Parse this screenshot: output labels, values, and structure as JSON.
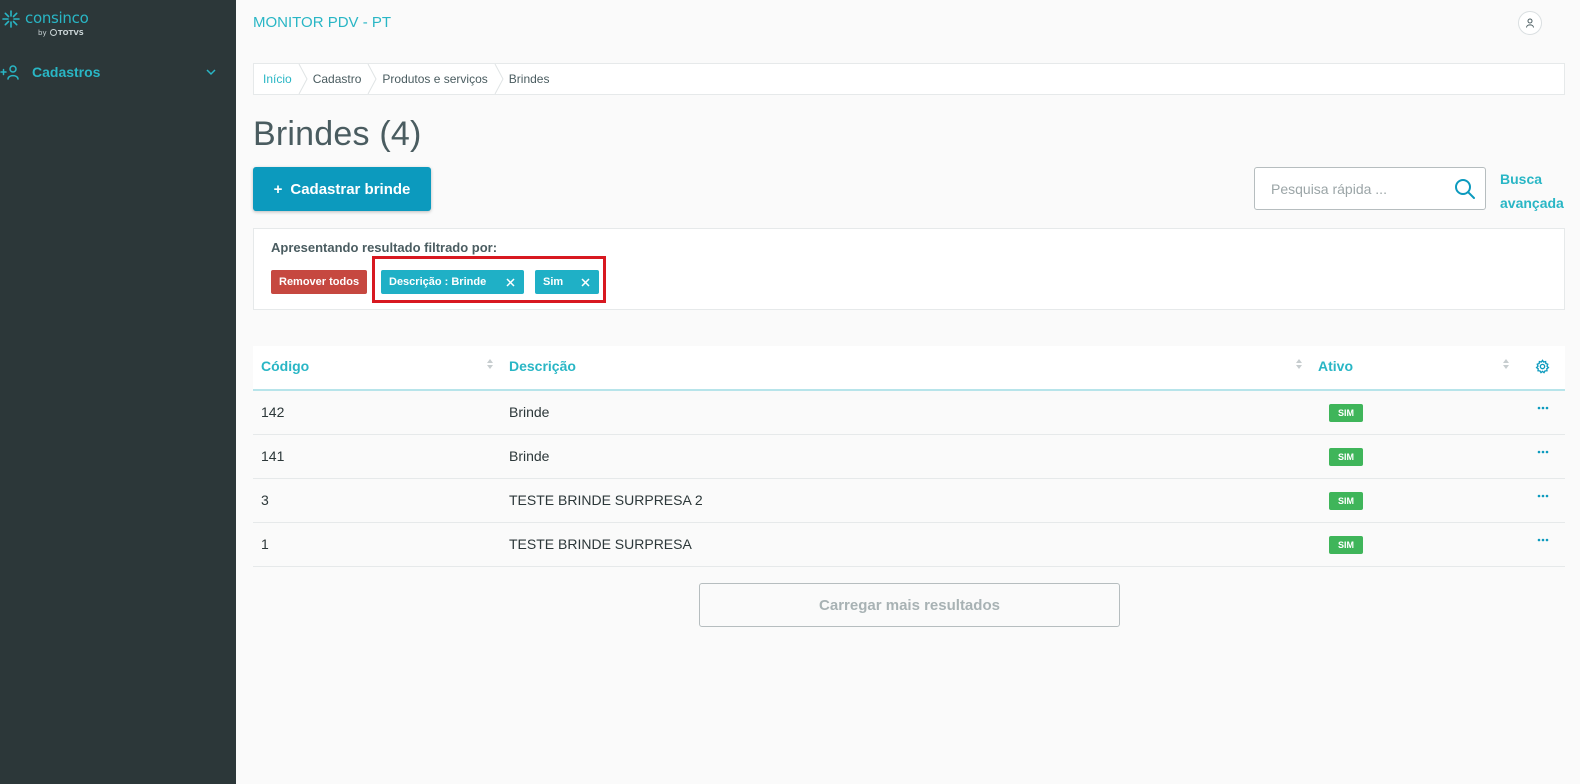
{
  "sidebar": {
    "logo": {
      "text": "consinco",
      "sub_by": "by",
      "sub_brand": "TOTVS"
    },
    "menu": [
      {
        "label": "Cadastros",
        "icon": "add-user-icon",
        "expanded": false
      }
    ]
  },
  "header": {
    "app_title": "MONITOR PDV - PT",
    "avatar_icon": "user-icon"
  },
  "breadcrumb": [
    "Início",
    "Cadastro",
    "Produtos e serviços",
    "Brindes"
  ],
  "page": {
    "title": "Brindes (4)",
    "add_button_icon": "+",
    "add_button_label": "Cadastrar brinde",
    "search_placeholder": "Pesquisa rápida ...",
    "advanced_search_line1": "Busca",
    "advanced_search_line2": "avançada"
  },
  "filters": {
    "label": "Apresentando resultado filtrado por:",
    "remove_all_label": "Remover todos",
    "chips": [
      "Descrição : Brinde",
      "Sim"
    ]
  },
  "table": {
    "columns": [
      "Código",
      "Descrição",
      "Ativo"
    ],
    "rows": [
      {
        "codigo": "142",
        "descricao": "Brinde",
        "ativo": "SIM"
      },
      {
        "codigo": "141",
        "descricao": "Brinde",
        "ativo": "SIM"
      },
      {
        "codigo": "3",
        "descricao": "TESTE BRINDE SURPRESA 2",
        "ativo": "SIM"
      },
      {
        "codigo": "1",
        "descricao": "TESTE BRINDE SURPRESA",
        "ativo": "SIM"
      }
    ]
  },
  "load_more_label": "Carregar mais resultados",
  "colors": {
    "sidebar_bg": "#2c3739",
    "accent": "#29b6c5",
    "primary_button": "#0c9abe",
    "danger": "#c64840",
    "chip": "#1fb0c6",
    "success_badge": "#3fb55a",
    "highlight_border": "#d81820"
  }
}
